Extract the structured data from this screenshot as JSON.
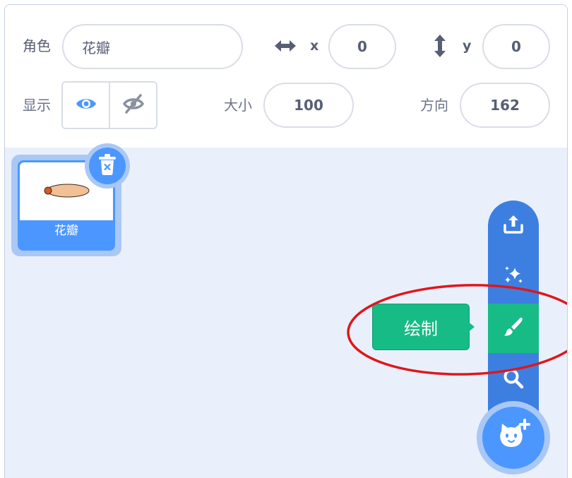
{
  "sprite_info": {
    "sprite_label": "角色",
    "sprite_name": "花瓣",
    "x_label": "x",
    "x_value": "0",
    "y_label": "y",
    "y_value": "0",
    "show_label": "显示",
    "size_label": "大小",
    "size_value": "100",
    "direction_label": "方向",
    "direction_value": "162"
  },
  "sprite_list": [
    {
      "name": "花瓣",
      "selected": true
    }
  ],
  "sprite_menu": {
    "items": [
      "upload-icon",
      "sparkle-icon",
      "paintbrush-icon",
      "search-icon"
    ],
    "active_tooltip": "绘制",
    "main_button": "cat-plus-icon"
  },
  "colors": {
    "accent": "#4c97ff",
    "menu": "#3d7fe0",
    "paint_active": "#17bb86",
    "annotation": "#e0161b",
    "pane_bg": "#e9f0fb"
  }
}
